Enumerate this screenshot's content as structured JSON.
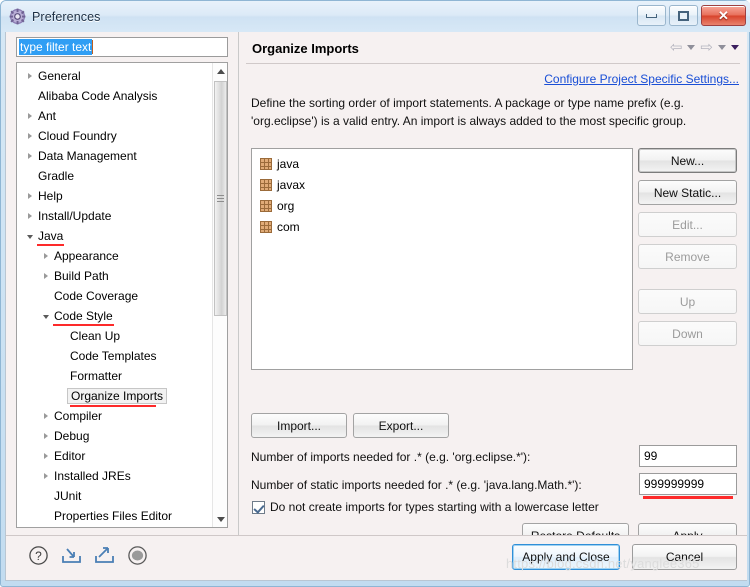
{
  "window": {
    "title": "Preferences",
    "icon": "gear-icon",
    "buttons": {
      "minimize": "minimize-icon",
      "maximize": "maximize-icon",
      "close": "✕"
    }
  },
  "filter": {
    "value": "type filter text",
    "placeholder": "type filter text"
  },
  "tree": {
    "items": [
      {
        "label": "General",
        "indent": 0,
        "state": "closed",
        "selected": false,
        "underline": false
      },
      {
        "label": "Alibaba Code Analysis",
        "indent": 0,
        "state": "leaf",
        "selected": false,
        "underline": false
      },
      {
        "label": "Ant",
        "indent": 0,
        "state": "closed",
        "selected": false,
        "underline": false
      },
      {
        "label": "Cloud Foundry",
        "indent": 0,
        "state": "closed",
        "selected": false,
        "underline": false
      },
      {
        "label": "Data Management",
        "indent": 0,
        "state": "closed",
        "selected": false,
        "underline": false
      },
      {
        "label": "Gradle",
        "indent": 0,
        "state": "leaf",
        "selected": false,
        "underline": false
      },
      {
        "label": "Help",
        "indent": 0,
        "state": "closed",
        "selected": false,
        "underline": false
      },
      {
        "label": "Install/Update",
        "indent": 0,
        "state": "closed",
        "selected": false,
        "underline": false
      },
      {
        "label": "Java",
        "indent": 0,
        "state": "open",
        "selected": false,
        "underline": true
      },
      {
        "label": "Appearance",
        "indent": 1,
        "state": "closed",
        "selected": false,
        "underline": false
      },
      {
        "label": "Build Path",
        "indent": 1,
        "state": "closed",
        "selected": false,
        "underline": false
      },
      {
        "label": "Code Coverage",
        "indent": 1,
        "state": "leaf",
        "selected": false,
        "underline": false
      },
      {
        "label": "Code Style",
        "indent": 1,
        "state": "open",
        "selected": false,
        "underline": true
      },
      {
        "label": "Clean Up",
        "indent": 2,
        "state": "leaf",
        "selected": false,
        "underline": false
      },
      {
        "label": "Code Templates",
        "indent": 2,
        "state": "leaf",
        "selected": false,
        "underline": false
      },
      {
        "label": "Formatter",
        "indent": 2,
        "state": "leaf",
        "selected": false,
        "underline": false
      },
      {
        "label": "Organize Imports",
        "indent": 2,
        "state": "leaf",
        "selected": true,
        "underline": true
      },
      {
        "label": "Compiler",
        "indent": 1,
        "state": "closed",
        "selected": false,
        "underline": false
      },
      {
        "label": "Debug",
        "indent": 1,
        "state": "closed",
        "selected": false,
        "underline": false
      },
      {
        "label": "Editor",
        "indent": 1,
        "state": "closed",
        "selected": false,
        "underline": false
      },
      {
        "label": "Installed JREs",
        "indent": 1,
        "state": "closed",
        "selected": false,
        "underline": false
      },
      {
        "label": "JUnit",
        "indent": 1,
        "state": "leaf",
        "selected": false,
        "underline": false
      },
      {
        "label": "Properties Files Editor",
        "indent": 1,
        "state": "leaf",
        "selected": false,
        "underline": false
      }
    ]
  },
  "page": {
    "title": "Organize Imports",
    "configure_link": "Configure Project Specific Settings...",
    "description": "Define the sorting order of import statements. A package or type name prefix (e.g. 'org.eclipse') is a valid entry. An import is always added to the most specific group."
  },
  "import_list": {
    "entries": [
      {
        "name": "java",
        "icon": "package-icon"
      },
      {
        "name": "javax",
        "icon": "package-icon"
      },
      {
        "name": "org",
        "icon": "package-icon"
      },
      {
        "name": "com",
        "icon": "package-icon"
      }
    ]
  },
  "side_buttons": [
    {
      "label": "New...",
      "accel": "N",
      "disabled": false,
      "default": true
    },
    {
      "label": "New Static...",
      "accel": "c",
      "disabled": false,
      "default": false
    },
    {
      "label": "Edit...",
      "accel": "E",
      "disabled": true,
      "default": false
    },
    {
      "label": "Remove",
      "accel": "R",
      "disabled": true,
      "default": false
    },
    {
      "label": "Up",
      "accel": "p",
      "disabled": true,
      "default": false
    },
    {
      "label": "Down",
      "accel": "w",
      "disabled": true,
      "default": false
    }
  ],
  "io_buttons": [
    {
      "label": "Import...",
      "accel": "m"
    },
    {
      "label": "Export...",
      "accel": "x"
    }
  ],
  "fields": [
    {
      "label": "Number of imports needed for .* (e.g. 'org.eclipse.*'):",
      "value": "99",
      "underlined": false
    },
    {
      "label": "Number of static imports needed for .* (e.g. 'java.lang.Math.*'):",
      "value": "999999999",
      "underlined": true
    }
  ],
  "checkbox": {
    "label": "Do not create imports for types starting with a lowercase letter",
    "checked": true
  },
  "page_buttons": [
    {
      "label": "Restore Defaults",
      "accel": "D"
    },
    {
      "label": "Apply",
      "accel": "A"
    }
  ],
  "bottom_icons": [
    {
      "name": "help-icon"
    },
    {
      "name": "import-preferences-icon"
    },
    {
      "name": "export-preferences-icon"
    },
    {
      "name": "show-advanced-icon"
    }
  ],
  "dialog_buttons": [
    {
      "label": "Apply and Close",
      "primary": true
    },
    {
      "label": "Cancel",
      "primary": false
    }
  ],
  "nav_icons": [
    {
      "name": "back-arrow-icon"
    },
    {
      "name": "back-dropdown-icon"
    },
    {
      "name": "forward-arrow-icon"
    },
    {
      "name": "forward-dropdown-icon"
    },
    {
      "name": "history-dropdown-icon"
    }
  ],
  "watermark": "https://blog.csdn.net/yanglee365",
  "colors": {
    "accent": "#1a4fd6",
    "selection": "#2f9ef4",
    "annotation_red": "#fd2a2a",
    "package_icon": "#e0ab77"
  }
}
